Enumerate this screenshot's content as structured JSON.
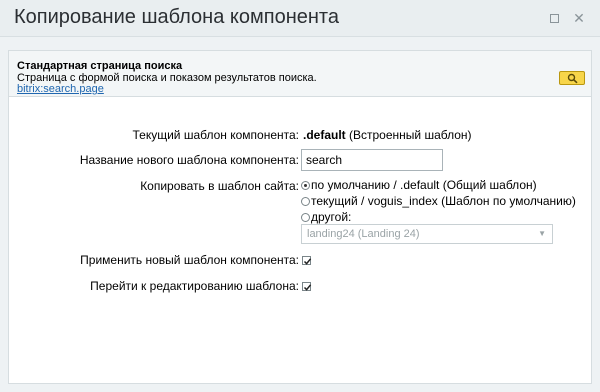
{
  "window": {
    "title": "Копирование шаблона компонента",
    "controls": {
      "maximize_icon": "square-icon",
      "close_icon": "close-icon",
      "close_glyph": "✕"
    }
  },
  "info": {
    "title": "Стандартная страница поиска",
    "description": "Страница с формой поиска и показом результатов поиска.",
    "link": "bitrix:search.page",
    "button_icon": "magnifier-icon"
  },
  "form": {
    "current_template": {
      "label": "Текущий шаблон компонента:",
      "value_name": ".default",
      "value_note": "(Встроенный шаблон)"
    },
    "new_name": {
      "label": "Название нового шаблона компонента:",
      "value": "search"
    },
    "copy_to": {
      "label": "Копировать в шаблон сайта:",
      "options": [
        {
          "label": "по умолчанию / .default (Общий шаблон)",
          "checked": true
        },
        {
          "label": "текущий / voguis_index (Шаблон по умолчанию)",
          "checked": false
        },
        {
          "label": "другой:",
          "checked": false
        }
      ],
      "other_select": "landing24 (Landing 24)"
    },
    "apply_new": {
      "label": "Применить новый шаблон компонента:",
      "checked": true
    },
    "go_edit": {
      "label": "Перейти к редактированию шаблона:",
      "checked": true
    }
  }
}
